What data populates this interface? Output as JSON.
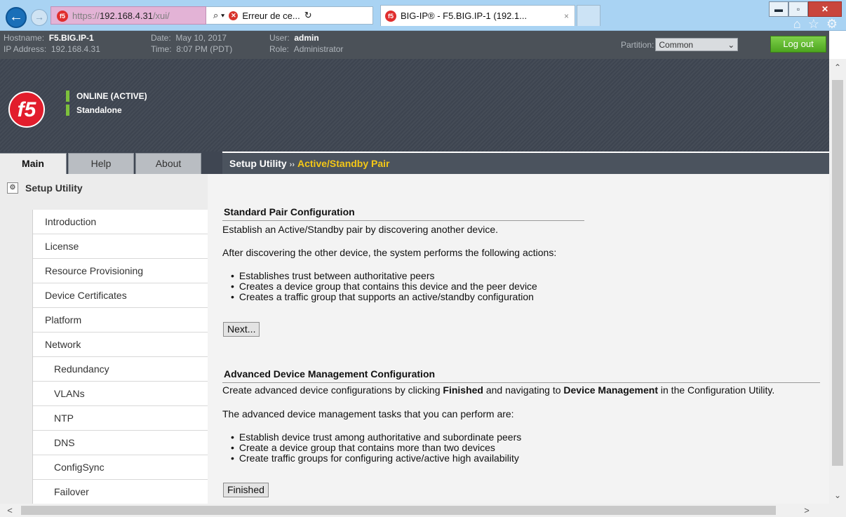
{
  "browser": {
    "url_scheme": "https://",
    "url_host": "192.168.4.31",
    "url_path": "/xui/",
    "search_glyph": "⌕ ▾",
    "error_tab_label": "Erreur de ce...",
    "refresh_glyph": "↻",
    "active_tab_title": "BIG-IP® - F5.BIG.IP-1 (192.1...",
    "tab_close": "×",
    "window_minimize": "▬",
    "window_maximize": "▫",
    "window_close": "✕",
    "toolbar_icons": [
      "home-icon",
      "star-icon",
      "gear-icon"
    ],
    "favicon_text": "f5"
  },
  "header": {
    "hostname_label": "Hostname:",
    "hostname": "F5.BIG.IP-1",
    "ip_label": "IP Address:",
    "ip": "192.168.4.31",
    "date_label": "Date:",
    "date": "May 10, 2017",
    "time_label": "Time:",
    "time": "8:07 PM (PDT)",
    "user_label": "User:",
    "user": "admin",
    "role_label": "Role:",
    "role": "Administrator",
    "partition_label": "Partition:",
    "partition_value": "Common",
    "logout_label": "Log out"
  },
  "banner": {
    "logo_text": "f5",
    "status_online": "ONLINE (ACTIVE)",
    "status_mode": "Standalone",
    "status_color": "#7dc13c"
  },
  "tabs": [
    {
      "label": "Main",
      "active": true
    },
    {
      "label": "Help",
      "active": false
    },
    {
      "label": "About",
      "active": false
    }
  ],
  "breadcrumb": {
    "root": "Setup Utility",
    "separator": "››",
    "current": "Active/Standby Pair",
    "current_color": "#f5c816"
  },
  "sidebar": {
    "title": "Setup Utility",
    "items": [
      {
        "label": "Introduction"
      },
      {
        "label": "License"
      },
      {
        "label": "Resource Provisioning"
      },
      {
        "label": "Device Certificates"
      },
      {
        "label": "Platform"
      },
      {
        "label": "Network"
      },
      {
        "label": "Redundancy"
      },
      {
        "label": "VLANs"
      },
      {
        "label": "NTP"
      },
      {
        "label": "DNS"
      },
      {
        "label": "ConfigSync"
      },
      {
        "label": "Failover"
      }
    ]
  },
  "main": {
    "standard": {
      "title": "Standard Pair Configuration",
      "intro": "Establish an Active/Standby pair by discovering another device.",
      "lead": "After discovering the other device, the system performs the following actions:",
      "bullets": [
        "Establishes trust between authoritative peers",
        "Creates a device group that contains this device and the peer device",
        "Creates a traffic group that supports an active/standby configuration"
      ],
      "button": "Next..."
    },
    "advanced": {
      "title": "Advanced Device Management Configuration",
      "intro_a": "Create advanced device configurations by clicking ",
      "intro_b": "Finished",
      "intro_c": " and navigating to ",
      "intro_d": "Device Management",
      "intro_e": " in the Configuration Utility.",
      "lead": "The advanced device management tasks that you can perform are:",
      "bullets": [
        "Establish device trust among authoritative and subordinate peers",
        "Create a device group that contains more than two devices",
        "Create traffic groups for configuring active/active high availability"
      ],
      "button": "Finished"
    }
  }
}
